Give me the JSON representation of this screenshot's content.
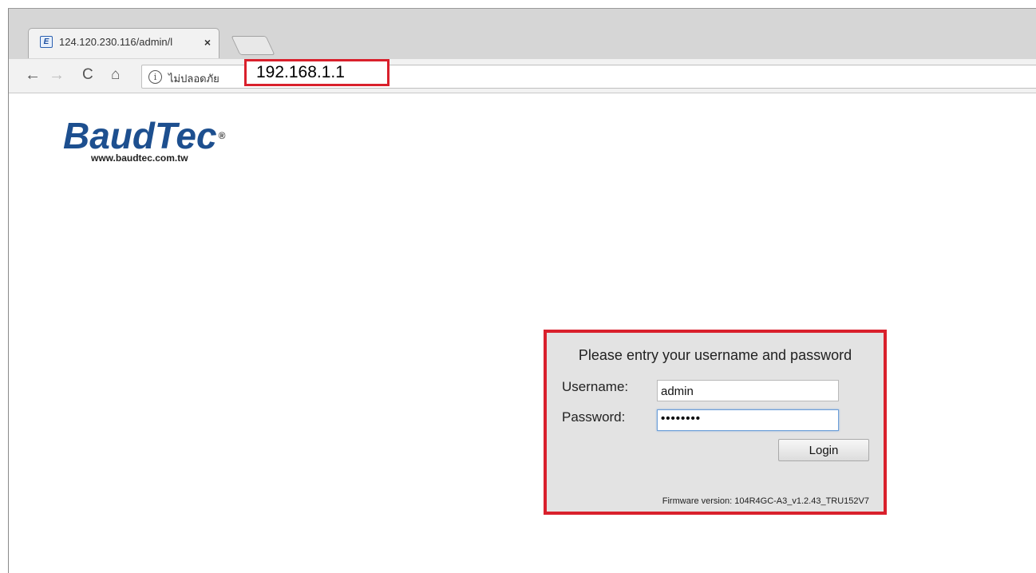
{
  "browser": {
    "tab_title": "124.120.230.116/admin/l",
    "tab_favicon": "E",
    "tab_close": "×",
    "insecure_label": "ไม่ปลอดภัย",
    "url": "192.168.1.1",
    "icons": {
      "back": "←",
      "forward": "→",
      "reload": "C",
      "home": "⌂",
      "info": "i"
    }
  },
  "brand": {
    "logo": "BaudTec",
    "registered": "®",
    "website": "www.baudtec.com.tw"
  },
  "login": {
    "prompt": "Please entry your username and password",
    "username_label": "Username:",
    "username_value": "admin",
    "password_label": "Password:",
    "password_value": "••••••••",
    "login_button": "Login",
    "firmware": "Firmware version: 104R4GC-A3_v1.2.43_TRU152V7"
  },
  "colors": {
    "highlight": "#d9202c",
    "brand_blue": "#1d4f8f"
  }
}
